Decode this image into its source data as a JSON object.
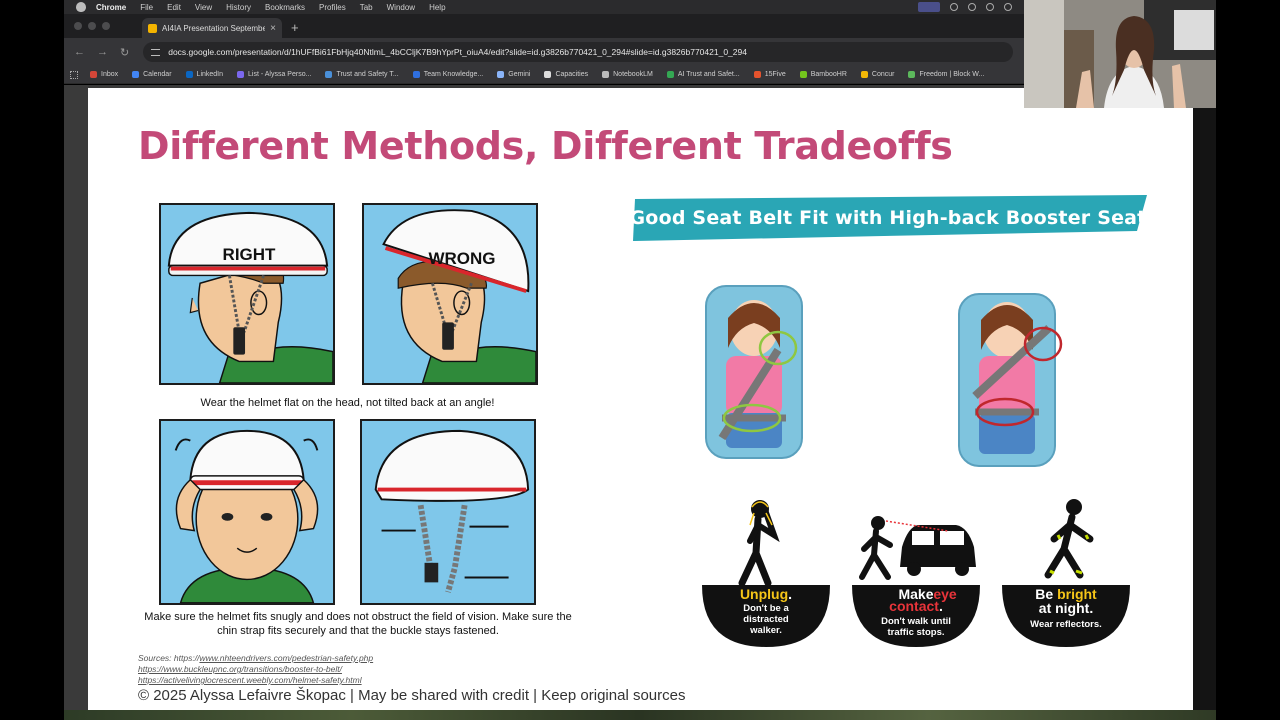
{
  "menubar": {
    "items": [
      "Chrome",
      "File",
      "Edit",
      "View",
      "History",
      "Bookmarks",
      "Profiles",
      "Tab",
      "Window",
      "Help"
    ]
  },
  "browser": {
    "tab_title": "AI4IA Presentation September",
    "url": "docs.google.com/presentation/d/1hUFfBi61FbHjq40NtlmL_4bCCljK7B9hYprPt_oiuA4/edit?slide=id.g3826b770421_0_294#slide=id.g3826b770421_0_294",
    "bookmarks": [
      {
        "label": "Inbox",
        "color": "#d44638"
      },
      {
        "label": "Calendar",
        "color": "#4285f4"
      },
      {
        "label": "LinkedIn",
        "color": "#0a66c2"
      },
      {
        "label": "List - Alyssa Perso...",
        "color": "#7b68ee"
      },
      {
        "label": "Trust and Safety T...",
        "color": "#4a90d9"
      },
      {
        "label": "Team Knowledge...",
        "color": "#2f6fde"
      },
      {
        "label": "Gemini",
        "color": "#8ab4f8"
      },
      {
        "label": "Capacities",
        "color": "#dddddd"
      },
      {
        "label": "NotebookLM",
        "color": "#bbbbbb"
      },
      {
        "label": "AI Trust and Safet...",
        "color": "#34a853"
      },
      {
        "label": "15Five",
        "color": "#e5532d"
      },
      {
        "label": "BambooHR",
        "color": "#73c41d"
      },
      {
        "label": "Concur",
        "color": "#f2b705"
      },
      {
        "label": "Freedom | Block W...",
        "color": "#5cb85c"
      }
    ]
  },
  "slide": {
    "title": "Different Methods, Different Tradeoffs",
    "helmet": {
      "right_label": "RIGHT",
      "wrong_label": "WRONG",
      "caption_top": "Wear the helmet flat on the head, not tilted back at an angle!",
      "caption_bottom": "Make sure the helmet fits snugly and does not obstruct the field of vision. Make sure the chin strap fits securely and that the buckle stays fastened."
    },
    "booster_banner": "Good Seat Belt Fit with High-back Booster Seat",
    "pedestrian": [
      {
        "line1_hl": "Unplug",
        "line1_rest": ".",
        "detail": [
          "Don't be a",
          "distracted",
          "walker."
        ]
      },
      {
        "line1": "Make",
        "line2_hl": "eye",
        "line3_hl": "contact",
        "line3_rest": ".",
        "detail": [
          "Don't walk until",
          "traffic stops."
        ]
      },
      {
        "line1": "Be",
        "line1_hl": "bright",
        "line2": "at night.",
        "detail": [
          "Wear reflectors."
        ]
      }
    ],
    "sources_prefix": "Sources: https://",
    "sources": [
      "www.nhteendrivers.com/pedestrian-safety.php",
      "https://www.buckleupnc.org/transitions/booster-to-belt/",
      "https://activelivinglocrescent.weebly.com/helmet-safety.html"
    ],
    "footer": "© 2025 Alyssa Lefaivre Škopac | May be shared with credit | Keep original sources"
  },
  "colors": {
    "title": "#c34a78",
    "banner": "#2aa6b5",
    "highlight_yellow": "#f5c518",
    "highlight_red": "#e8343a"
  }
}
